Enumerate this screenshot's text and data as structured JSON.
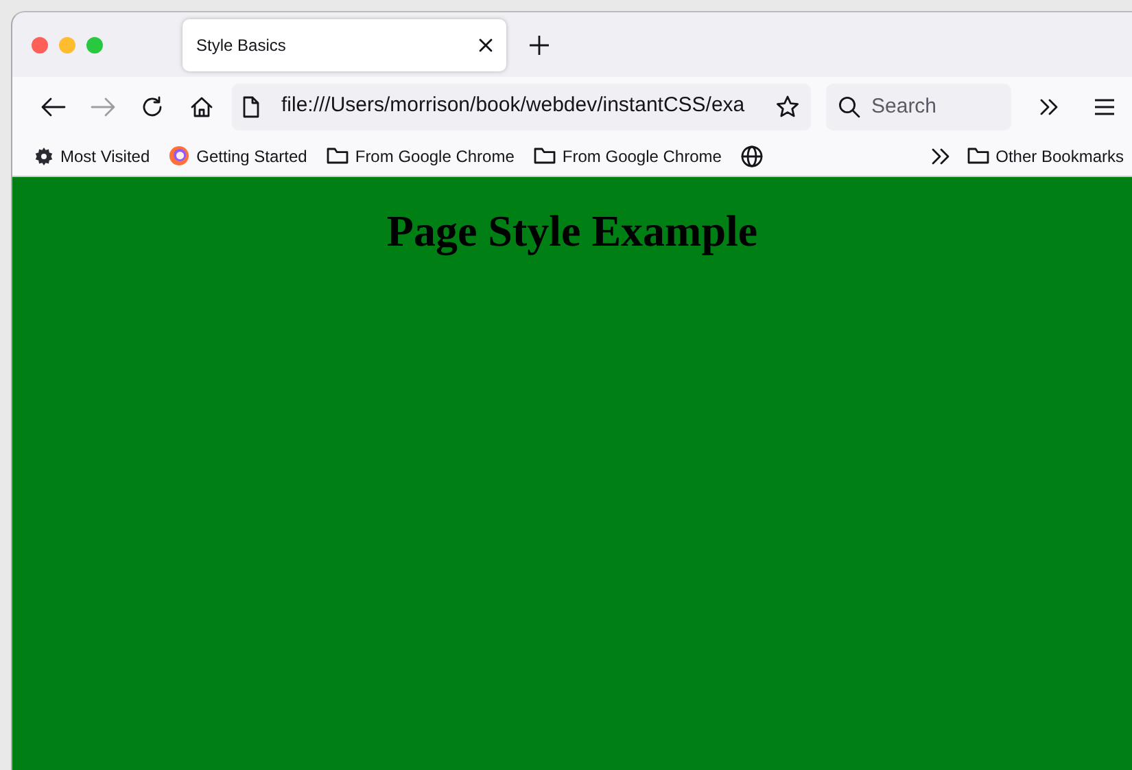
{
  "tabs": [
    {
      "title": "Style Basics",
      "selected": true
    }
  ],
  "toolbar": {
    "url": "file:///Users/morrison/book/webdev/instantCSS/exa",
    "search_placeholder": "Search"
  },
  "bookmarks": [
    {
      "kind": "gear",
      "label": "Most Visited"
    },
    {
      "kind": "firefox",
      "label": "Getting Started"
    },
    {
      "kind": "folder",
      "label": "From Google Chrome"
    },
    {
      "kind": "folder",
      "label": "From Google Chrome"
    },
    {
      "kind": "globe"
    }
  ],
  "other_bookmarks": {
    "label": "Other Bookmarks"
  },
  "page": {
    "heading": "Page Style Example"
  }
}
